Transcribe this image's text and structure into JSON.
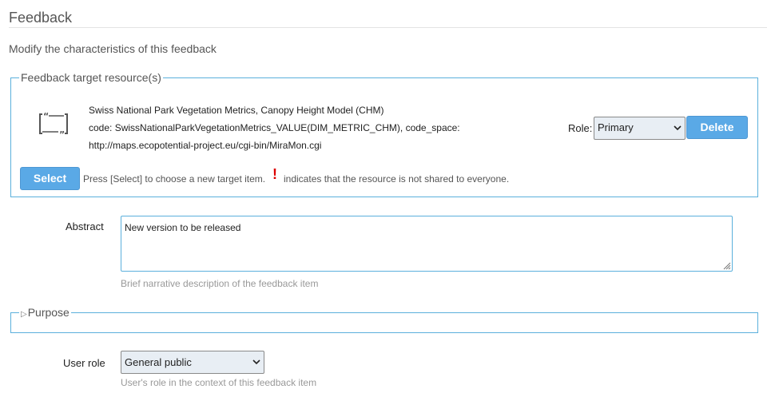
{
  "page": {
    "title": "Feedback",
    "subtitle": "Modify the characteristics of this feedback"
  },
  "target": {
    "legend": "Feedback target resource(s)",
    "icon": "quote-frame-icon",
    "resource_title": "Swiss National Park Vegetation Metrics, Canopy Height Model (CHM)",
    "resource_code": "code: SwissNationalParkVegetationMetrics_VALUE(DIM_METRIC_CHM), code_space:",
    "resource_url": "http://maps.ecopotential-project.eu/cgi-bin/MiraMon.cgi",
    "role_label": "Role:",
    "role_value": "Primary",
    "delete_label": "Delete",
    "select_label": "Select",
    "hint_before": "Press [Select] to choose a new target item.",
    "hint_mark": "!",
    "hint_after": "indicates that the resource is not shared to everyone."
  },
  "abstract": {
    "label": "Abstract",
    "value": "New version to be released",
    "help": "Brief narrative description of the feedback item"
  },
  "purpose": {
    "legend": "Purpose",
    "collapsed_icon": "triangle-right-icon"
  },
  "user_role": {
    "label": "User role",
    "value": "General public",
    "help": "User's role in the context of this feedback item"
  },
  "colors": {
    "accent_border": "#5bb0dc",
    "button_bg": "#5aa9e6",
    "warning": "#dd0000"
  }
}
